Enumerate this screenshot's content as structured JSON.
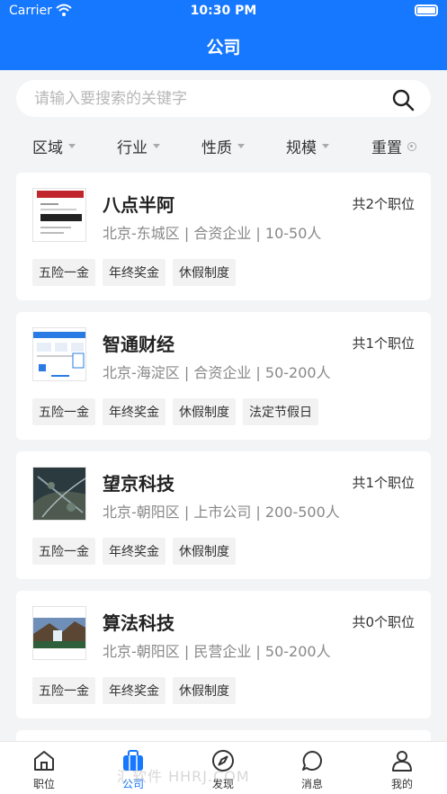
{
  "status_bar": {
    "carrier": "Carrier",
    "time": "10:30 PM"
  },
  "header": {
    "title": "公司"
  },
  "search": {
    "placeholder": "请输入要搜索的关键字"
  },
  "filters": [
    {
      "label": "区域"
    },
    {
      "label": "行业"
    },
    {
      "label": "性质"
    },
    {
      "label": "规模"
    },
    {
      "label": "重置"
    }
  ],
  "companies": [
    {
      "name": "八点半阿",
      "jobs": "共2个职位",
      "info": "北京-东城区 | 合资企业 | 10-50人",
      "tags": [
        "五险一金",
        "年终奖金",
        "休假制度"
      ]
    },
    {
      "name": "智通财经",
      "jobs": "共1个职位",
      "info": "北京-海淀区 | 合资企业 | 50-200人",
      "tags": [
        "五险一金",
        "年终奖金",
        "休假制度",
        "法定节假日"
      ]
    },
    {
      "name": "望京科技",
      "jobs": "共1个职位",
      "info": "北京-朝阳区 | 上市公司 | 200-500人",
      "tags": [
        "五险一金",
        "年终奖金",
        "休假制度"
      ]
    },
    {
      "name": "算法科技",
      "jobs": "共0个职位",
      "info": "北京-朝阳区 | 民营企业 | 50-200人",
      "tags": [
        "五险一金",
        "年终奖金",
        "休假制度"
      ]
    }
  ],
  "tabbar": [
    {
      "label": "职位",
      "icon": "home-icon"
    },
    {
      "label": "公司",
      "icon": "briefcase-icon"
    },
    {
      "label": "发现",
      "icon": "compass-icon"
    },
    {
      "label": "消息",
      "icon": "chat-icon"
    },
    {
      "label": "我的",
      "icon": "user-icon"
    }
  ],
  "watermark": "汇软件 HHRJ.COM",
  "colors": {
    "primary": "#1677ff",
    "background": "#f3f4f6"
  }
}
